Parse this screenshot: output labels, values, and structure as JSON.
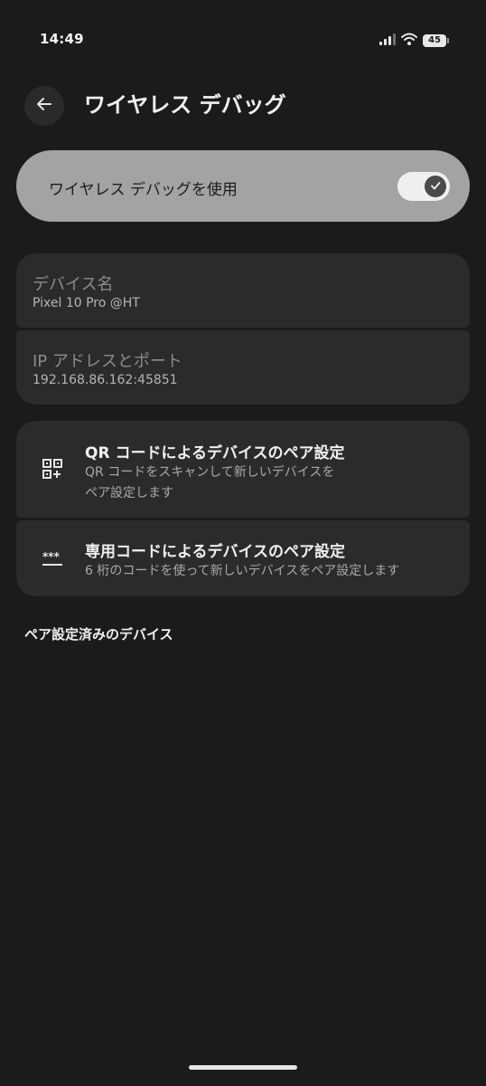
{
  "status_bar": {
    "time": "14:49",
    "battery": "45"
  },
  "header": {
    "title": "ワイヤレス デバッグ"
  },
  "main_toggle": {
    "label": "ワイヤレス デバッグを使用",
    "state": "on"
  },
  "device_info": {
    "name_title": "デバイス名",
    "name_value": "Pixel 10 Pro @HT",
    "ip_title": "IP アドレスとポート",
    "ip_value": "192.168.86.162:45851"
  },
  "pair_options": [
    {
      "icon": "qr-code-icon",
      "title": "QR コードによるデバイスのペア設定",
      "desc_line1": "QR コードをスキャンして新しいデバイスを",
      "desc_line2": "ペア設定します"
    },
    {
      "icon": "pin-code-icon",
      "title": "専用コードによるデバイスのペア設定",
      "desc_line1": "6 桁のコードを使って新しいデバイスをペア設定します"
    }
  ],
  "paired_section": {
    "title": "ペア設定済みのデバイス"
  },
  "colors": {
    "background": "#1b1b1b",
    "card": "#2b2b2b",
    "toggle_card": "#a3a3a3"
  }
}
